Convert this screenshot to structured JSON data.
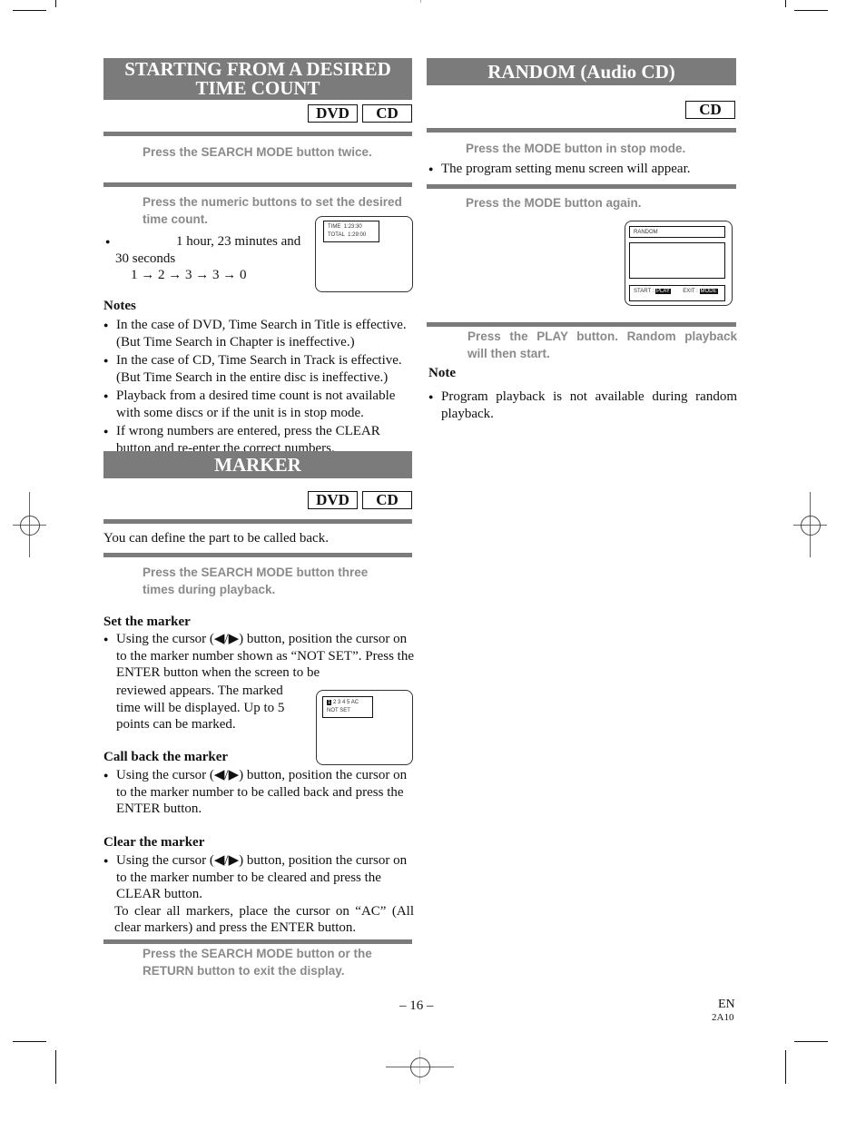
{
  "left": {
    "time_count": {
      "title_line1": "STARTING FROM A DESIRED",
      "title_line2": "TIME COUNT",
      "badges": [
        "DVD",
        "CD"
      ],
      "step1": "Press the SEARCH MODE button twice.",
      "step2_line1": "Press the numeric buttons to set the desired",
      "step2_line2": "time count.",
      "example_line1": "1 hour, 23 minutes and",
      "example_line2": "30 seconds",
      "example_sequence": "1 → 2 → 3 → 3 → 0",
      "osd": {
        "time_label": "TIME",
        "time_value": "1:23:30",
        "total_label": "TOTAL",
        "total_value": "1:29:00"
      },
      "notes_heading": "Notes",
      "notes": [
        "In the case of DVD, Time Search in Title is effective. (But Time Search in Chapter is ineffective.)",
        "In the case of CD, Time Search in Track is effective. (But Time Search in the entire disc is ineffective.)",
        "Playback from a desired time count is not available with some discs or if the unit is in stop mode.",
        "If wrong numbers are entered, press the CLEAR button and re-enter the correct numbers."
      ]
    },
    "marker": {
      "title": "MARKER",
      "badges": [
        "DVD",
        "CD"
      ],
      "intro": "You can define the part to be called back.",
      "step1_line1": "Press the SEARCH MODE button three",
      "step1_line2": "times during playback.",
      "set_heading": "Set the marker",
      "set_text_a": "Using the cursor (◀/▶) button, position the cursor on to the marker number shown as “NOT SET”. Press the ENTER button when the screen to be",
      "set_text_b": "reviewed appears. The marked time will be displayed. Up to 5 points can be marked.",
      "osd": {
        "cursor": "1",
        "numbers": "2 3 4 5 AC",
        "status": "NOT SET"
      },
      "call_heading": "Call back the marker",
      "call_text": "Using the cursor (◀/▶) button, position the cursor on to the marker number to be called back and press the ENTER button.",
      "clear_heading": "Clear the marker",
      "clear_text": "Using the cursor (◀/▶) button, position the cursor on to the marker number to be cleared and press the CLEAR button.",
      "clear_all_text": "To clear all markers, place the cursor on “AC” (All clear markers) and press the ENTER button.",
      "exit_step_line1": "Press the SEARCH MODE button or the",
      "exit_step_line2": "RETURN button to exit the display."
    }
  },
  "right": {
    "random": {
      "title": "RANDOM (Audio CD)",
      "badge": "CD",
      "step1": "Press the MODE button in stop mode.",
      "step1_bullet": "The program setting menu screen will appear.",
      "step2": "Press the MODE button again.",
      "osd": {
        "header": "RANDOM",
        "start_label": "START :",
        "start_key": "PLAY",
        "exit_label": "EXIT :",
        "exit_key": "MODE"
      },
      "step3_line1": "Press the PLAY button. Random playback",
      "step3_line2": "will then start.",
      "note_heading": "Note",
      "note": "Program playback is not available during random playback."
    }
  },
  "footer": {
    "page_number": "– 16 –",
    "language": "EN",
    "code": "2A10"
  }
}
